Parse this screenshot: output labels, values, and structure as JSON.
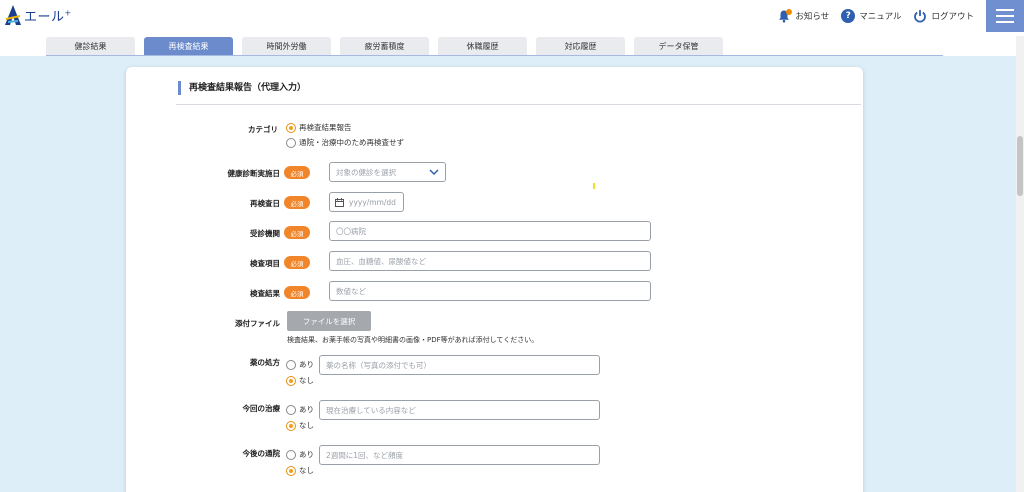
{
  "app": {
    "logo_text": "エール",
    "logo_sup": "+"
  },
  "header": {
    "notice_label": "お知らせ",
    "manual_label": "マニュアル",
    "logout_label": "ログアウト"
  },
  "tabs": [
    {
      "label": "健診結果",
      "active": false
    },
    {
      "label": "再検査結果",
      "active": true
    },
    {
      "label": "時間外労働",
      "active": false
    },
    {
      "label": "疲労蓄積度",
      "active": false
    },
    {
      "label": "休職履歴",
      "active": false
    },
    {
      "label": "対応履歴",
      "active": false
    },
    {
      "label": "データ保管",
      "active": false
    }
  ],
  "form": {
    "title": "再検査結果報告（代理入力）",
    "required_label": "必須",
    "category": {
      "label": "カテゴリ",
      "options": [
        {
          "label": "再検査結果報告",
          "selected": true
        },
        {
          "label": "通院・治療中のため再検査せず",
          "selected": false
        }
      ]
    },
    "checkup_date": {
      "label": "健康診断実施日",
      "placeholder": "対象の健診を選択"
    },
    "recheck_date": {
      "label": "再検査日",
      "placeholder": "yyyy/mm/dd"
    },
    "clinic": {
      "label": "受診機関",
      "placeholder": "〇〇病院"
    },
    "items": {
      "label": "検査項目",
      "placeholder": "血圧、血糖値、尿酸値など"
    },
    "result": {
      "label": "検査結果",
      "placeholder": "数値など"
    },
    "attachment": {
      "label": "添付ファイル",
      "button": "ファイルを選択",
      "note": "検査結果、お薬手帳の写真や明細書の画像・PDF等があれば添付してください。"
    },
    "prescription": {
      "label": "薬の処方",
      "yes": "あり",
      "no": "なし",
      "selected": "no",
      "placeholder": "薬の名称（写真の添付でも可）"
    },
    "treatment": {
      "label": "今回の治療",
      "yes": "あり",
      "no": "なし",
      "selected": "no",
      "placeholder": "現在治療している内容など"
    },
    "visits": {
      "label": "今後の通院",
      "yes": "あり",
      "no": "なし",
      "selected": "no",
      "placeholder": "2週間に1回、など頻度"
    }
  },
  "colors": {
    "accent": "#6b8bcd",
    "required": "#f0852a",
    "brand": "#1a3f8c"
  }
}
